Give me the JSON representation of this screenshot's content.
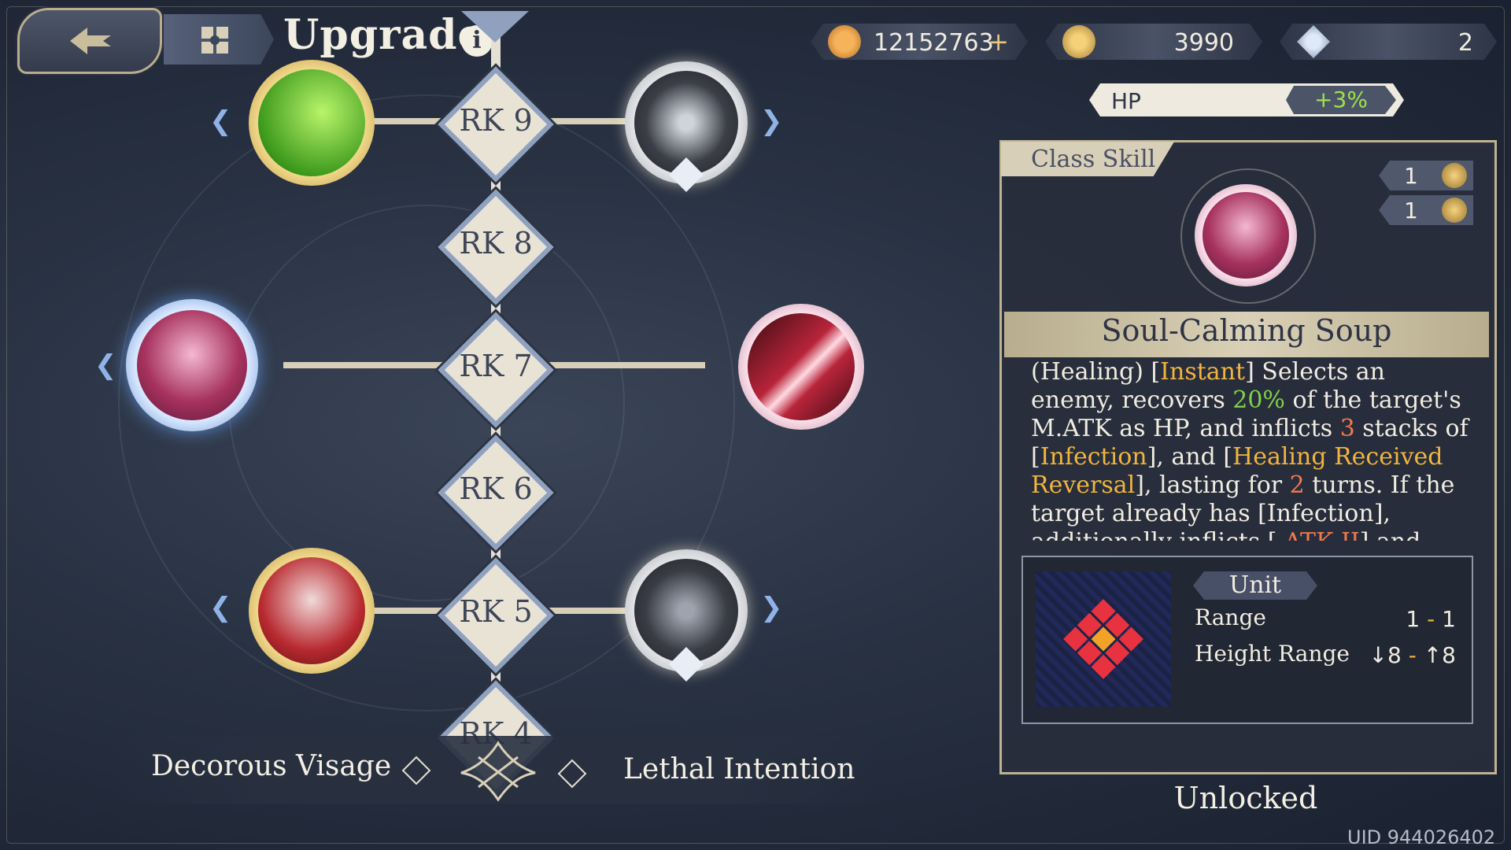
{
  "header": {
    "title": "Upgrade",
    "back_icon": "back-arrow-icon",
    "menu_icon": "grid-menu-icon",
    "info_icon": "info-icon",
    "info_glyph": "i"
  },
  "currencies": [
    {
      "icon": "coin-icon",
      "value": "12152763",
      "has_plus": true
    },
    {
      "icon": "star-orb-icon",
      "value": "3990"
    },
    {
      "icon": "crystal-icon",
      "value": "2"
    }
  ],
  "stat_bonus": {
    "label": "HP",
    "value": "+3%",
    "value_color": "#9fe04a"
  },
  "rank_tree": {
    "ranks": [
      "RK 9",
      "RK 8",
      "RK 7",
      "RK 6",
      "RK 5",
      "RK 4"
    ],
    "rank_4_visible_text": "RK 4"
  },
  "paths": {
    "left_label": "Decorous Visage",
    "right_label": "Lethal Intention"
  },
  "skill_panel": {
    "tab_label": "Class Skill",
    "cost_value": "1",
    "cooldown_value": "1",
    "skill_name": "Soul-Calming Soup",
    "description": [
      {
        "t": "(Healing) ["
      },
      {
        "t": "Instant",
        "c": "y"
      },
      {
        "t": "] Selects an enemy, recovers "
      },
      {
        "t": "20%",
        "c": "g"
      },
      {
        "t": " of the target's M.ATK as HP, and inflicts "
      },
      {
        "t": "3",
        "c": "o"
      },
      {
        "t": " stacks of ["
      },
      {
        "t": "Infection",
        "c": "y"
      },
      {
        "t": "], and ["
      },
      {
        "t": "Healing Received Reversal",
        "c": "y"
      },
      {
        "t": "], lasting for "
      },
      {
        "t": "2",
        "c": "o"
      },
      {
        "t": " turns. If the target already has [Infection], additionally inflicts [ "
      },
      {
        "t": "ATK II",
        "c": "o"
      },
      {
        "t": "] and [Sleep]."
      }
    ],
    "range_box": {
      "unit_label": "Unit",
      "range_label": "Range",
      "range_min": "1",
      "range_max": "1",
      "height_label": "Height Range",
      "height_min": "↓8",
      "height_max": "↑8",
      "dash": "-"
    },
    "status": "Unlocked"
  },
  "uid": "UID 944026402",
  "colors": {
    "accent_gold": "#bfb391",
    "highlight_yellow": "#f1b53e",
    "green": "#7fd24a",
    "orange": "#f07a4c"
  }
}
